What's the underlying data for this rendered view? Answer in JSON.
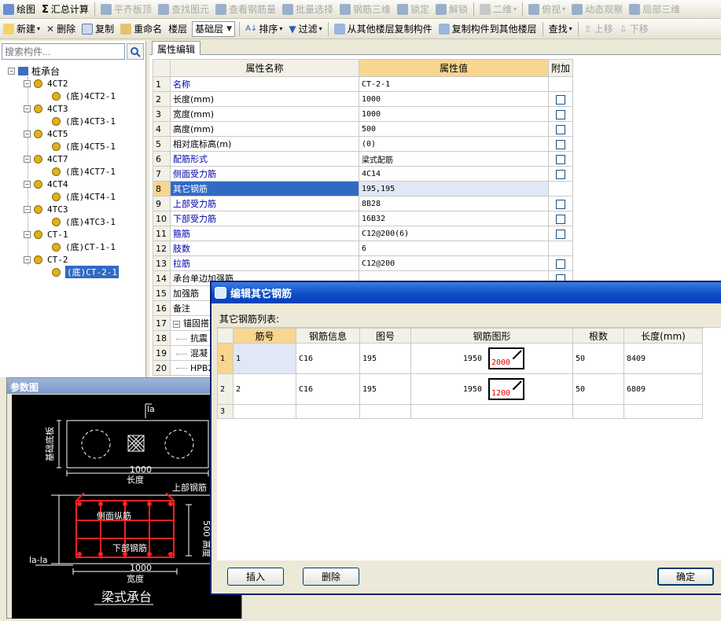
{
  "toolbar1": {
    "items": [
      {
        "label": "绘图",
        "icon": "draw-icon",
        "enabled": true
      },
      {
        "label": "汇总计算",
        "icon": "sigma-icon",
        "enabled": true
      },
      {
        "label": "平齐板顶",
        "icon": "align-top-icon",
        "enabled": false
      },
      {
        "label": "查找图元",
        "icon": "find-element-icon",
        "enabled": false
      },
      {
        "label": "查看钢筋量",
        "icon": "view-rebar-icon",
        "enabled": false
      },
      {
        "label": "批量选择",
        "icon": "batch-select-icon",
        "enabled": false
      },
      {
        "label": "钢筋三维",
        "icon": "rebar-3d-icon",
        "enabled": false
      },
      {
        "label": "锁定",
        "icon": "lock-icon",
        "enabled": false
      },
      {
        "label": "解锁",
        "icon": "unlock-icon",
        "enabled": false
      },
      {
        "label": "二维",
        "icon": "view-2d-icon",
        "enabled": false
      },
      {
        "label": "俯视",
        "icon": "top-view-icon",
        "enabled": false
      },
      {
        "label": "动态观察",
        "icon": "orbit-icon",
        "enabled": false
      },
      {
        "label": "局部三维",
        "icon": "local-3d-icon",
        "enabled": false
      }
    ]
  },
  "toolbar2": {
    "new_label": "新建",
    "delete_label": "删除",
    "copy_label": "复制",
    "rename_label": "重命名",
    "floor_label": "楼层",
    "floor_value": "基础层",
    "sort_label": "排序",
    "filter_label": "过滤",
    "copy_from_label": "从其他楼层复制构件",
    "copy_to_label": "复制构件到其他楼层",
    "find_label": "查找",
    "up_label": "上移",
    "down_label": "下移"
  },
  "sidebar": {
    "search_placeholder": "搜索构件...",
    "root": "桩承台",
    "nodes": [
      {
        "name": "4CT2",
        "child": "(底)4CT2-1"
      },
      {
        "name": "4CT3",
        "child": "(底)4CT3-1"
      },
      {
        "name": "4CT5",
        "child": "(底)4CT5-1"
      },
      {
        "name": "4CT7",
        "child": "(底)4CT7-1"
      },
      {
        "name": "4CT4",
        "child": "(底)4CT4-1"
      },
      {
        "name": "4TC3",
        "child": "(底)4TC3-1"
      },
      {
        "name": "CT-1",
        "child": "(底)CT-1-1"
      },
      {
        "name": "CT-2",
        "child": "(底)CT-2-1"
      }
    ]
  },
  "props": {
    "tab": "属性编辑",
    "col_name": "属性名称",
    "col_value": "属性值",
    "col_extra": "附加",
    "rows": [
      {
        "n": "1",
        "name": "名称",
        "value": "CT-2-1",
        "extra": false,
        "link": true
      },
      {
        "n": "2",
        "name": "长度(mm)",
        "value": "1000",
        "extra": true,
        "link": false
      },
      {
        "n": "3",
        "name": "宽度(mm)",
        "value": "1000",
        "extra": true,
        "link": false
      },
      {
        "n": "4",
        "name": "高度(mm)",
        "value": "500",
        "extra": true,
        "link": false
      },
      {
        "n": "5",
        "name": "相对底标高(m)",
        "value": "(0)",
        "extra": true,
        "link": false
      },
      {
        "n": "6",
        "name": "配筋形式",
        "value": "梁式配筋",
        "extra": true,
        "link": true
      },
      {
        "n": "7",
        "name": "侧面受力筋",
        "value": "4C14",
        "extra": true,
        "link": true
      },
      {
        "n": "8",
        "name": "其它钢筋",
        "value": "195,195",
        "extra": false,
        "link": true
      },
      {
        "n": "9",
        "name": "上部受力筋",
        "value": "8B28",
        "extra": true,
        "link": true
      },
      {
        "n": "10",
        "name": "下部受力筋",
        "value": "16B32",
        "extra": true,
        "link": true
      },
      {
        "n": "11",
        "name": "箍筋",
        "value": "C12@200(6)",
        "extra": true,
        "link": true
      },
      {
        "n": "12",
        "name": "肢数",
        "value": "6",
        "extra": false,
        "link": true
      },
      {
        "n": "13",
        "name": "拉筋",
        "value": "C12@200",
        "extra": true,
        "link": true
      },
      {
        "n": "14",
        "name": "承台单边加强筋",
        "value": "",
        "extra": true,
        "link": false
      },
      {
        "n": "15",
        "name": "加强筋",
        "value": "",
        "extra": false,
        "link": false
      },
      {
        "n": "16",
        "name": "备注",
        "value": "",
        "extra": false,
        "link": false
      },
      {
        "n": "17",
        "name": "锚固搭",
        "value": "",
        "extra": false,
        "link": false
      },
      {
        "n": "18",
        "name": "抗震",
        "value": "",
        "extra": false,
        "link": false
      },
      {
        "n": "19",
        "name": "混凝",
        "value": "",
        "extra": false,
        "link": false
      },
      {
        "n": "20",
        "name": "HPB2",
        "value": "",
        "extra": false,
        "link": false
      }
    ]
  },
  "param": {
    "title": "参数图",
    "len_1000": "1000",
    "len_label": "长度",
    "width_1000": "1000",
    "width_label": "宽度",
    "height_500": "500",
    "height_label": "高度",
    "top_bar": "上部钢筋",
    "side_bar": "侧面纵筋",
    "bottom_bar": "下部钢筋",
    "base_label": "基础底板",
    "la": "la",
    "la_la": "la-la",
    "caption": "梁式承台"
  },
  "dialog": {
    "title": "编辑其它钢筋",
    "subtitle": "其它钢筋列表:",
    "cols": [
      "筋号",
      "钢筋信息",
      "图号",
      "钢筋图形",
      "根数",
      "长度(mm)"
    ],
    "rows": [
      {
        "n": "1",
        "no": "1",
        "info": "C16",
        "fig": "195",
        "dim": "1950",
        "len_in_shape": "2000",
        "count": "50",
        "length": "8409"
      },
      {
        "n": "2",
        "no": "2",
        "info": "C16",
        "fig": "195",
        "dim": "1950",
        "len_in_shape": "1200",
        "count": "50",
        "length": "6809"
      },
      {
        "n": "3",
        "no": "",
        "info": "",
        "fig": "",
        "dim": "",
        "len_in_shape": "",
        "count": "",
        "length": ""
      }
    ],
    "insert_label": "插入",
    "delete_label": "删除",
    "ok_label": "确定"
  }
}
